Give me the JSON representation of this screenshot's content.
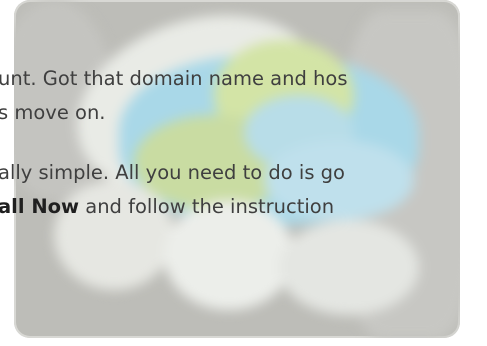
{
  "content": {
    "line1": "unt. Got that domain name and hos",
    "line2": "s move on.",
    "line3": "ally simple. All you need to do is go",
    "line4_bold": "all Now",
    "line4_rest": " and follow the instruction"
  }
}
